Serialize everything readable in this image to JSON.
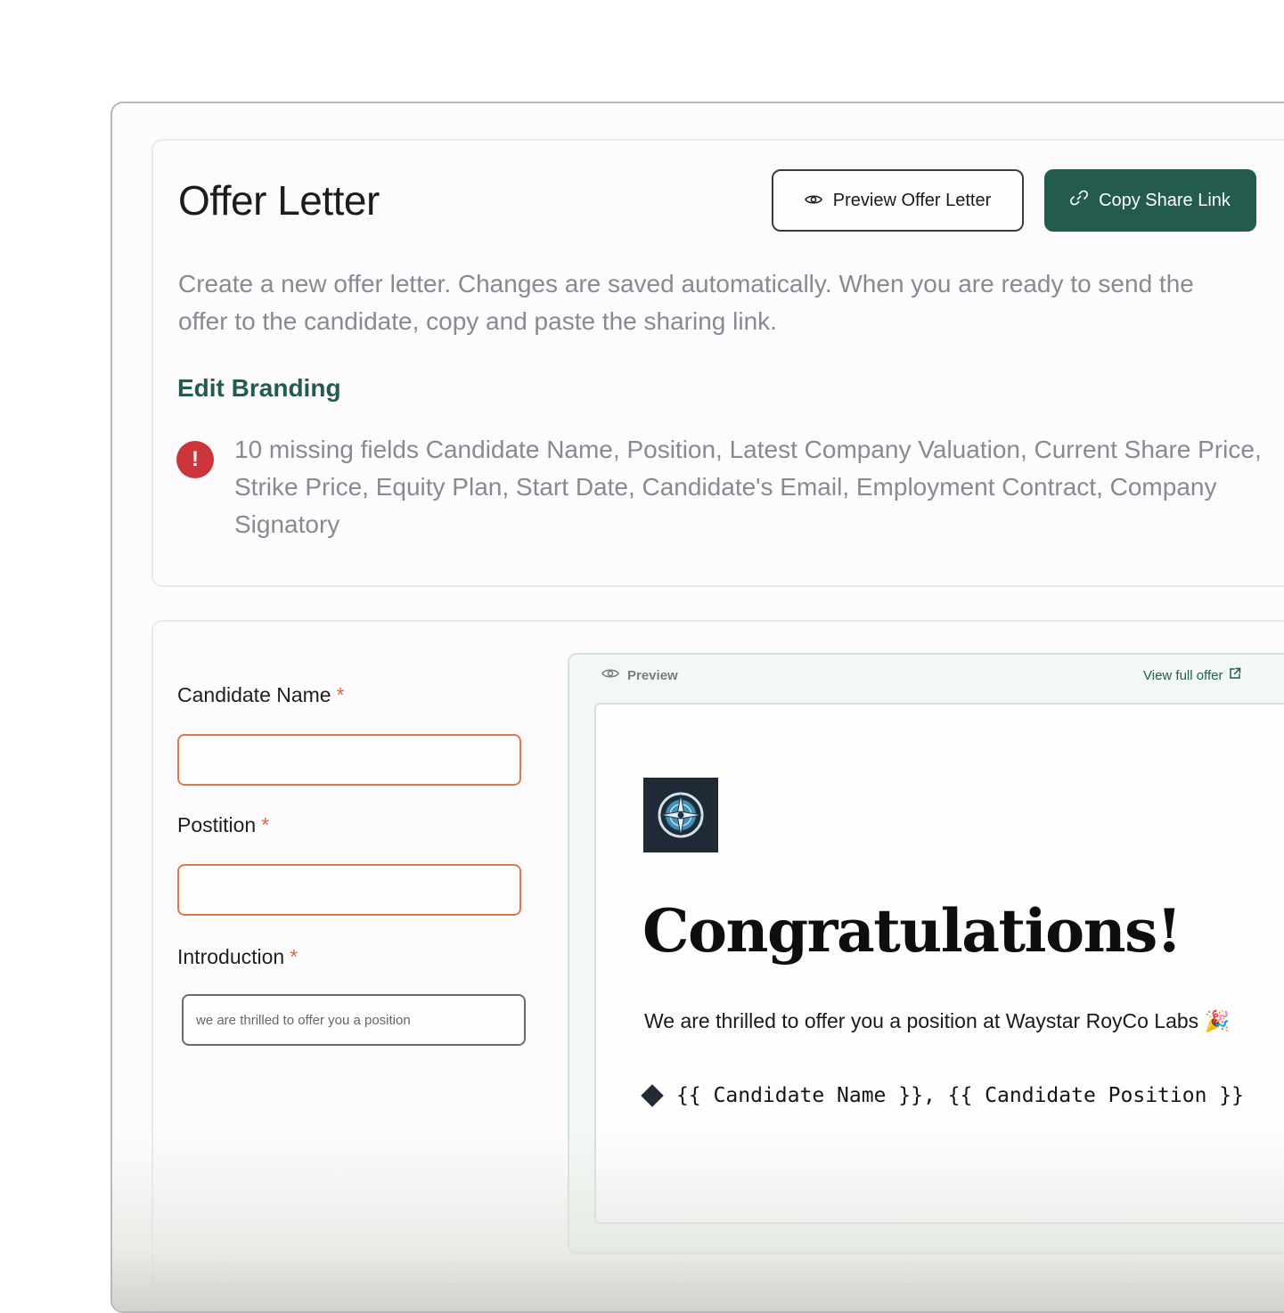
{
  "header": {
    "title": "Offer Letter",
    "preview_button_label": "Preview Offer Letter",
    "copy_button_label": "Copy Share Link"
  },
  "description": "Create a new offer letter. Changes are saved automatically. When you are ready to send the offer to the candidate, copy and paste the sharing link.",
  "edit_branding_label": "Edit Branding",
  "alert": {
    "icon_symbol": "!",
    "message": "10 missing fields Candidate Name, Position, Latest Company Valuation, Current Share Price, Strike Price, Equity Plan, Start Date, Candidate's Email, Employment Contract, Company Signatory"
  },
  "form": {
    "candidate_name": {
      "label": "Candidate Name",
      "required_mark": "*",
      "value": ""
    },
    "position": {
      "label": "Postition",
      "required_mark": "*",
      "value": ""
    },
    "introduction": {
      "label": "Introduction",
      "required_mark": "*",
      "value": "we are thrilled to offer you a position"
    }
  },
  "preview": {
    "header_label": "Preview",
    "view_full_label": "View full offer",
    "heading": "Congratulations!",
    "offer_line": "We are thrilled to offer you a position at Waystar RoyCo Labs 🎉",
    "placeholder_line": "{{ Candidate Name }}, {{ Candidate Position }}"
  },
  "colors": {
    "brand_green": "#235c4c",
    "error_red": "#cc353a",
    "required_orange": "#e06a35",
    "input_error_border": "#df7a45"
  },
  "icons": {
    "preview_button": "eye-icon",
    "copy_button": "link-icon",
    "alert": "alert-icon",
    "preview_header": "eye-icon",
    "view_full": "external-link-icon",
    "logo": "compass-logo-icon",
    "bullet": "diamond-icon"
  }
}
